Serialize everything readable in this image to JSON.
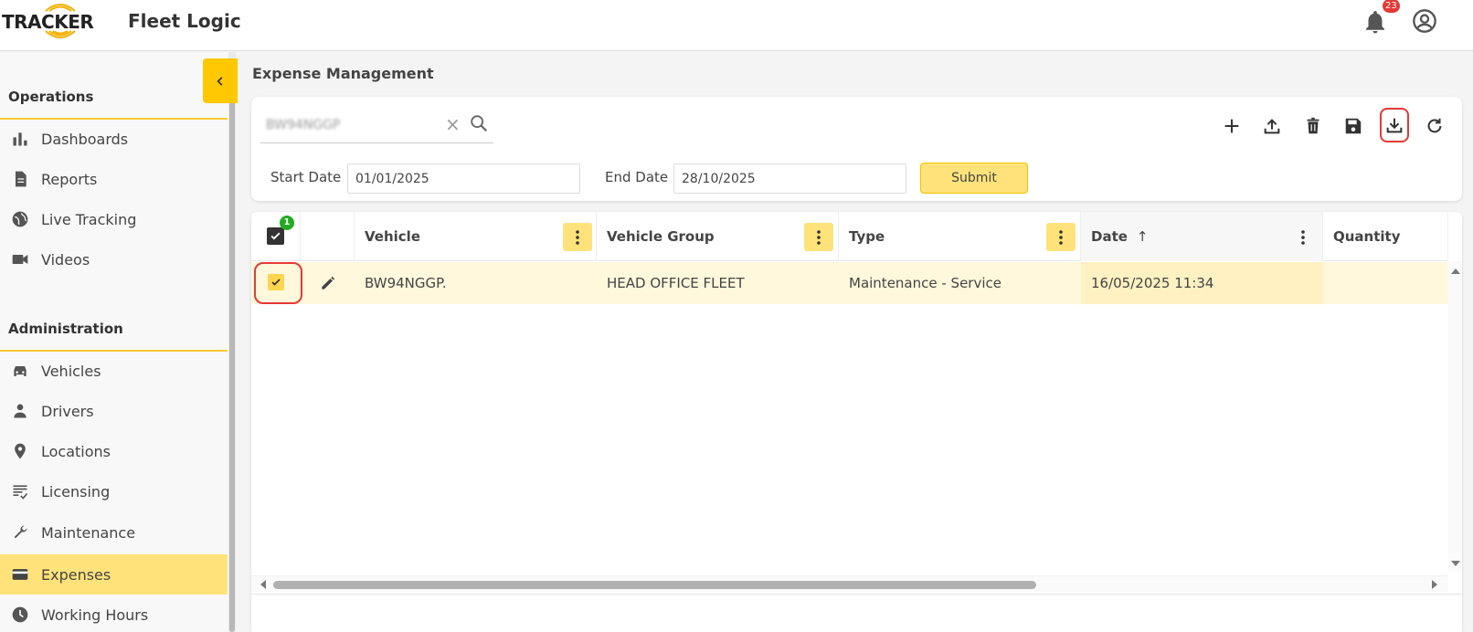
{
  "header": {
    "logo_word": "TRACKER",
    "app_name": "Fleet Logic",
    "notification_count": "23"
  },
  "sidebar": {
    "operations_title": "Operations",
    "operations_items": [
      {
        "label": "Dashboards",
        "icon": "bar-chart-icon"
      },
      {
        "label": "Reports",
        "icon": "document-icon"
      },
      {
        "label": "Live Tracking",
        "icon": "globe-icon"
      },
      {
        "label": "Videos",
        "icon": "video-camera-icon"
      }
    ],
    "administration_title": "Administration",
    "administration_items": [
      {
        "label": "Vehicles",
        "icon": "car-icon"
      },
      {
        "label": "Drivers",
        "icon": "person-icon"
      },
      {
        "label": "Locations",
        "icon": "location-pin-icon"
      },
      {
        "label": "Licensing",
        "icon": "checklist-icon"
      },
      {
        "label": "Maintenance",
        "icon": "wrench-icon"
      },
      {
        "label": "Expenses",
        "icon": "credit-card-icon",
        "active": true
      },
      {
        "label": "Working Hours",
        "icon": "clock-icon"
      }
    ]
  },
  "main": {
    "page_title": "Expense Management",
    "search": {
      "value": "BW94NGGP"
    },
    "filters": {
      "start_label": "Start Date",
      "start_value": "01/01/2025",
      "end_label": "End Date",
      "end_value": "28/10/2025",
      "submit_label": "Submit"
    },
    "toolbar": [
      "add-icon",
      "upload-icon",
      "delete-icon",
      "save-icon",
      "download-icon",
      "refresh-icon"
    ]
  },
  "grid": {
    "selected_count": "1",
    "columns": [
      "Vehicle",
      "Vehicle Group",
      "Type",
      "Date",
      "Quantity"
    ],
    "sort_indicator": "↑",
    "rows": [
      {
        "vehicle": "BW94NGGP.",
        "vehicle_group": "HEAD OFFICE FLEET",
        "type": "Maintenance - Service",
        "date": "16/05/2025 11:34",
        "quantity": ""
      }
    ]
  },
  "colors": {
    "accent": "#ffc800",
    "active_row": "#fff8dc",
    "highlight": "#e53935"
  }
}
